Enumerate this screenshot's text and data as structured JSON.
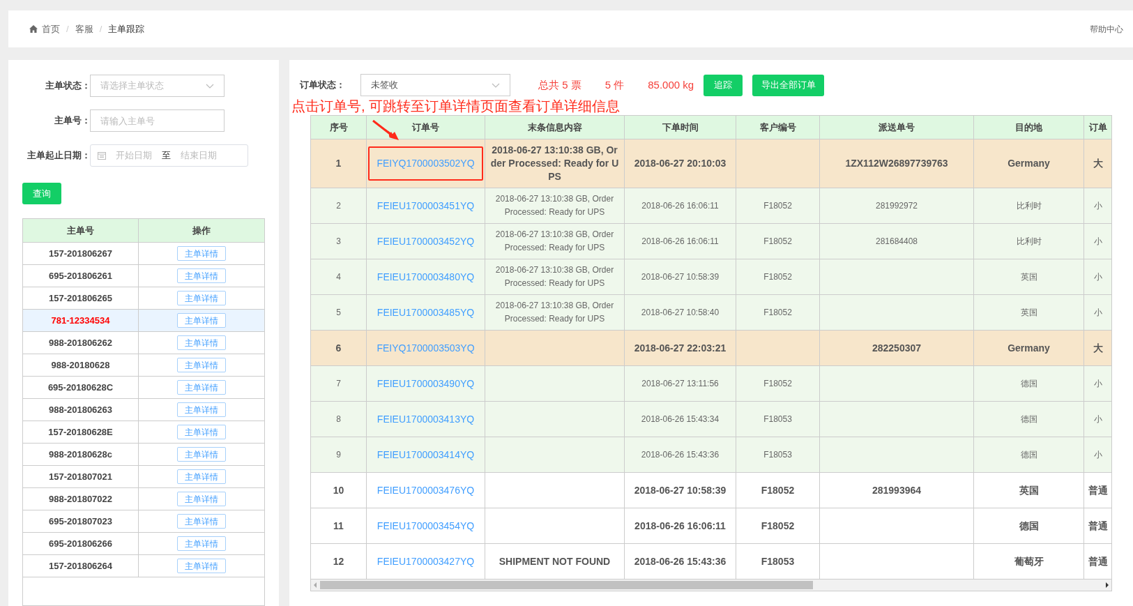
{
  "breadcrumb": [
    "首页",
    "客服",
    "主单跟踪"
  ],
  "breadcrumb_separator": "/",
  "help_link": "帮助中心",
  "filters": {
    "status_label": "主单状态：",
    "status_placeholder": "请选择主单状态",
    "number_label": "主单号：",
    "number_placeholder": "请输入主单号",
    "date_label": "主单起止日期：",
    "start_placeholder": "开始日期",
    "date_separator": "至",
    "end_placeholder": "结束日期",
    "query_button": "查询"
  },
  "master_table": {
    "columns": [
      "主单号",
      "操作"
    ],
    "rows": [
      {
        "number": "157-201806267",
        "action": "主单详情",
        "selected": false
      },
      {
        "number": "695-201806261",
        "action": "主单详情",
        "selected": false
      },
      {
        "number": "157-201806265",
        "action": "主单详情",
        "selected": false
      },
      {
        "number": "781-12334534",
        "action": "主单详情",
        "selected": true
      },
      {
        "number": "988-201806262",
        "action": "主单详情",
        "selected": false
      },
      {
        "number": "988-20180628",
        "action": "主单详情",
        "selected": false
      },
      {
        "number": "695-20180628C",
        "action": "主单详情",
        "selected": false
      },
      {
        "number": "988-201806263",
        "action": "主单详情",
        "selected": false
      },
      {
        "number": "157-20180628E",
        "action": "主单详情",
        "selected": false
      },
      {
        "number": "988-20180628c",
        "action": "主单详情",
        "selected": false
      },
      {
        "number": "157-201807021",
        "action": "主单详情",
        "selected": false
      },
      {
        "number": "988-201807022",
        "action": "主单详情",
        "selected": false
      },
      {
        "number": "695-201807023",
        "action": "主单详情",
        "selected": false
      },
      {
        "number": "695-201806266",
        "action": "主单详情",
        "selected": false
      },
      {
        "number": "157-201806264",
        "action": "主单详情",
        "selected": false
      }
    ]
  },
  "order_toolbar": {
    "status_label": "订单状态：",
    "status_value": "未签收",
    "total": "总共 5 票",
    "pieces": "5 件",
    "weight": "85.000 kg",
    "track_button": "追踪",
    "export_button": "导出全部订单"
  },
  "annotation": "点击订单号, 可跳转至订单详情页面查看订单详细信息",
  "order_table": {
    "columns": [
      "序号",
      "订单号",
      "末条信息内容",
      "下单时间",
      "客户编号",
      "派送单号",
      "目的地",
      "订单"
    ],
    "rows": [
      {
        "kind": "highlight",
        "marked": true,
        "index": "1",
        "order": "FEIYQ1700003502YQ",
        "info": "2018-06-27 13:10:38 GB, Order Processed: Ready for UPS",
        "time": "2018-06-27 20:10:03",
        "delivery": "1ZX112W26897739763",
        "destination": "Germany",
        "column_8": "大"
      },
      {
        "kind": "signed",
        "marked": false,
        "index": "2",
        "order": "FEIEU1700003451YQ",
        "info": "2018-06-27 13:10:38 GB, Order Processed: Ready for UPS",
        "time": "2018-06-26 16:06:11",
        "customer": "F18052",
        "delivery": "281992972",
        "destination": "比利时",
        "column_8": "小"
      },
      {
        "kind": "signed",
        "marked": false,
        "index": "3",
        "order": "FEIEU1700003452YQ",
        "info": "2018-06-27 13:10:38 GB, Order Processed: Ready for UPS",
        "time": "2018-06-26 16:06:11",
        "customer": "F18052",
        "delivery": "281684408",
        "destination": "比利时",
        "column_8": "小"
      },
      {
        "kind": "signed",
        "marked": false,
        "index": "4",
        "order": "FEIEU1700003480YQ",
        "info": "2018-06-27 13:10:38 GB, Order Processed: Ready for UPS",
        "time": "2018-06-27 10:58:39",
        "customer": "F18052",
        "destination": "英国",
        "column_8": "小"
      },
      {
        "kind": "signed",
        "marked": false,
        "index": "5",
        "order": "FEIEU1700003485YQ",
        "info": "2018-06-27 13:10:38 GB, Order Processed: Ready for UPS",
        "time": "2018-06-27 10:58:40",
        "customer": "F18052",
        "destination": "英国",
        "column_8": "小"
      },
      {
        "kind": "highlight",
        "marked": false,
        "index": "6",
        "order": "FEIYQ1700003503YQ",
        "time": "2018-06-27 22:03:21",
        "delivery": "282250307",
        "destination": "Germany",
        "column_8": "大"
      },
      {
        "kind": "signed",
        "marked": false,
        "index": "7",
        "order": "FEIEU1700003490YQ",
        "time": "2018-06-27 13:11:56",
        "customer": "F18052",
        "destination": "德国",
        "column_8": "小"
      },
      {
        "kind": "signed",
        "marked": false,
        "index": "8",
        "order": "FEIEU1700003413YQ",
        "time": "2018-06-26 15:43:34",
        "customer": "F18053",
        "destination": "德国",
        "column_8": "小"
      },
      {
        "kind": "signed",
        "marked": false,
        "index": "9",
        "order": "FEIEU1700003414YQ",
        "time": "2018-06-26 15:43:36",
        "customer": "F18053",
        "destination": "德国",
        "column_8": "小"
      },
      {
        "kind": "plain",
        "marked": false,
        "index": "10",
        "order": "FEIEU1700003476YQ",
        "time": "2018-06-27 10:58:39",
        "customer": "F18052",
        "delivery": "281993964",
        "destination": "英国",
        "column_8": "普通"
      },
      {
        "kind": "plain",
        "marked": false,
        "index": "11",
        "order": "FEIEU1700003454YQ",
        "time": "2018-06-26 16:06:11",
        "customer": "F18052",
        "destination": "德国",
        "column_8": "普通"
      },
      {
        "kind": "plain",
        "marked": false,
        "index": "12",
        "order": "FEIEU1700003427YQ",
        "info": "SHIPMENT NOT FOUND",
        "time": "2018-06-26 15:43:36",
        "customer": "F18053",
        "destination": "葡萄牙",
        "column_8": "普通"
      }
    ]
  }
}
